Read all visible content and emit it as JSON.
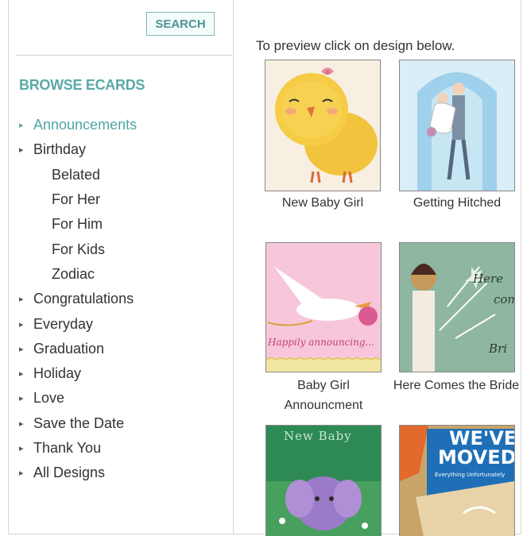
{
  "sidebar": {
    "search_label": "SEARCH",
    "browse_title": "BROWSE ECARDS",
    "categories": [
      {
        "label": "Announcements"
      },
      {
        "label": "Birthday"
      },
      {
        "label": "Belated"
      },
      {
        "label": "For Her"
      },
      {
        "label": "For Him"
      },
      {
        "label": "For Kids"
      },
      {
        "label": "Zodiac"
      },
      {
        "label": "Congratulations"
      },
      {
        "label": "Everyday"
      },
      {
        "label": "Graduation"
      },
      {
        "label": "Holiday"
      },
      {
        "label": "Love"
      },
      {
        "label": "Save the Date"
      },
      {
        "label": "Thank You"
      },
      {
        "label": "All Designs"
      }
    ]
  },
  "main": {
    "instruction": "To preview click on design below.",
    "cards": [
      {
        "title": "New Baby Girl"
      },
      {
        "title": "Getting Hitched"
      },
      {
        "title_line1": "Baby Girl",
        "title_line2": "Announcment",
        "thumb_text": "Happily announcing..."
      },
      {
        "title": "Here Comes the Bride",
        "thumb_text_1": "Here",
        "thumb_text_2": "com",
        "thumb_text_3": "Bri"
      },
      {
        "thumb_text": "New Baby"
      },
      {
        "thumb_text_1": "WE'VE",
        "thumb_text_2": "MOVED",
        "thumb_text_3": "Everything Unfortunately"
      }
    ]
  },
  "colors": {
    "accent": "#4ea6a3",
    "title": "#5aa9a6",
    "text": "#333333"
  }
}
